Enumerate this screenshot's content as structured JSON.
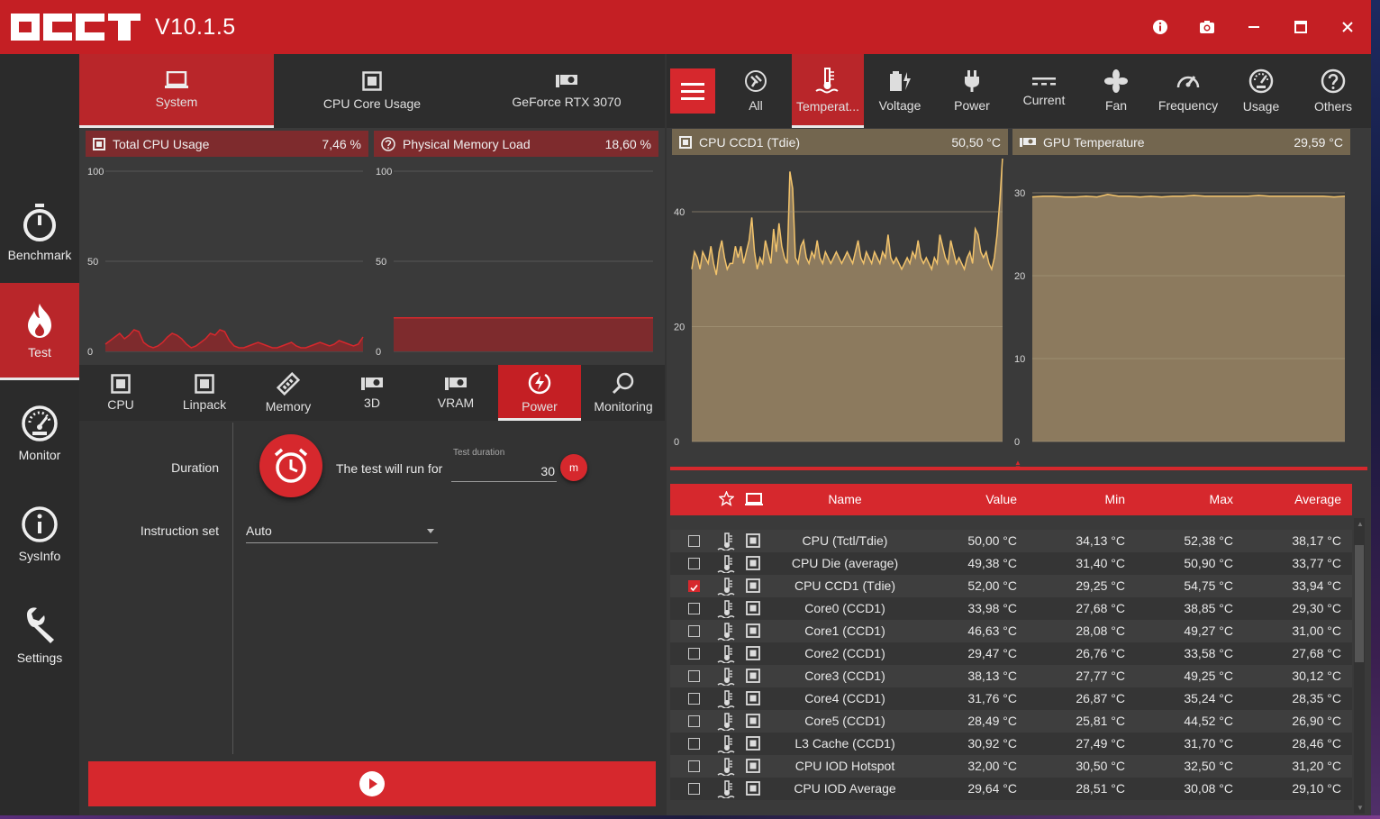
{
  "app": {
    "version": "V10.1.5"
  },
  "titlebar_buttons": [
    "info-icon",
    "camera-icon",
    "minimize-icon",
    "maximize-icon",
    "close-icon"
  ],
  "nav": [
    {
      "label": "Benchmark",
      "icon": "stopwatch-icon"
    },
    {
      "label": "Test",
      "icon": "flame-icon",
      "active": true
    },
    {
      "label": "Monitor",
      "icon": "gauge-icon"
    },
    {
      "label": "SysInfo",
      "icon": "info-icon"
    },
    {
      "label": "Settings",
      "icon": "wrench-icon"
    }
  ],
  "top_tabs": [
    {
      "label": "System",
      "icon": "laptop-icon",
      "active": true
    },
    {
      "label": "CPU Core Usage",
      "icon": "chip-icon"
    },
    {
      "label": "GeForce RTX 3070",
      "icon": "gpu-icon"
    }
  ],
  "system_charts": {
    "cpu": {
      "title": "Total CPU Usage",
      "value": "7,46 %"
    },
    "memory": {
      "title": "Physical Memory Load",
      "value": "18,60 %"
    }
  },
  "test_tabs": [
    {
      "label": "CPU",
      "icon": "chip-icon"
    },
    {
      "label": "Linpack",
      "icon": "chip-icon"
    },
    {
      "label": "Memory",
      "icon": "memory-icon"
    },
    {
      "label": "3D",
      "icon": "gpu-icon"
    },
    {
      "label": "VRAM",
      "icon": "gpu-icon"
    },
    {
      "label": "Power",
      "icon": "power-icon",
      "active": true
    },
    {
      "label": "Monitoring",
      "icon": "magnifier-icon"
    }
  ],
  "settings": {
    "duration_label": "Duration",
    "run_text": "The test will run for",
    "duration_caption": "Test duration",
    "duration_value": "30",
    "duration_unit": "m",
    "instruction_label": "Instruction set",
    "instruction_value": "Auto"
  },
  "monitor_tabs": [
    {
      "label": "All",
      "icon": "wrench-icon"
    },
    {
      "label": "Temperat...",
      "icon": "thermometer-icon",
      "active": true
    },
    {
      "label": "Voltage",
      "icon": "battery-icon"
    },
    {
      "label": "Power",
      "icon": "plug-icon"
    },
    {
      "label": "Current",
      "icon": "dc-current-icon"
    },
    {
      "label": "Fan",
      "icon": "fan-icon"
    },
    {
      "label": "Frequency",
      "icon": "speedometer-icon"
    },
    {
      "label": "Usage",
      "icon": "gauge-icon"
    },
    {
      "label": "Others",
      "icon": "question-icon"
    }
  ],
  "monitor_charts": {
    "cpu_ccd1": {
      "title": "CPU CCD1 (Tdie)",
      "value": "50,50 °C"
    },
    "gpu_temp": {
      "title": "GPU Temperature",
      "value": "29,59 °C"
    }
  },
  "chart_data": [
    {
      "type": "area",
      "title": "Total CPU Usage",
      "ylim": [
        0,
        100
      ],
      "yticks": [
        "100",
        "50",
        "0"
      ],
      "values": [
        4,
        6,
        8,
        10,
        7,
        9,
        12,
        11,
        5,
        3,
        2,
        3,
        5,
        8,
        10,
        9,
        7,
        4,
        2,
        3,
        5,
        7,
        10,
        9,
        12,
        11,
        6,
        3,
        2,
        2,
        3,
        4,
        5,
        4,
        3,
        2,
        2,
        3,
        4,
        5,
        3,
        2,
        2,
        3,
        4,
        5,
        4,
        3,
        4,
        6,
        5,
        4,
        3,
        4,
        8
      ]
    },
    {
      "type": "area",
      "title": "Physical Memory Load",
      "ylim": [
        0,
        100
      ],
      "yticks": [
        "100",
        "50",
        "0"
      ],
      "values": [
        18.6,
        18.6
      ]
    },
    {
      "type": "area",
      "title": "CPU CCD1 (Tdie)",
      "ylim": [
        0,
        48
      ],
      "yticks": [
        "40",
        "20",
        "0"
      ],
      "values": [
        30,
        33,
        32,
        30,
        33,
        32,
        31,
        34,
        31,
        29,
        33,
        35,
        32,
        30,
        31,
        31,
        34,
        32,
        34,
        31,
        33,
        35,
        39,
        33,
        30,
        32,
        31,
        35,
        33,
        31,
        37,
        33,
        38,
        34,
        32,
        31,
        47,
        44,
        32,
        31,
        34,
        35,
        32,
        31,
        33,
        32,
        35,
        32,
        31,
        33,
        32,
        31,
        32,
        33,
        32,
        31,
        32,
        33,
        32,
        31,
        33,
        35,
        32,
        31,
        33,
        32,
        31,
        33,
        32,
        31,
        33,
        32,
        36,
        32,
        31,
        32,
        31,
        30,
        31,
        32,
        31,
        33,
        32,
        35,
        32,
        31,
        32,
        31,
        30,
        32,
        31,
        36,
        34,
        32,
        31,
        35,
        33,
        31,
        32,
        31,
        30,
        32,
        33,
        31,
        37,
        36,
        33,
        32,
        33,
        31,
        30,
        32,
        36,
        42,
        49.5
      ]
    },
    {
      "type": "area",
      "title": "GPU Temperature",
      "ylim": [
        0,
        30
      ],
      "yticks": [
        "30",
        "20",
        "10",
        "0"
      ],
      "values": [
        29.5,
        29.6,
        29.6,
        29.5,
        29.5,
        29.6,
        29.5,
        29.8,
        29.6,
        29.6,
        29.5,
        29.6,
        29.5,
        29.6,
        29.6,
        29.7,
        29.6,
        29.6,
        29.6,
        29.6,
        29.6,
        29.7,
        29.6,
        29.6,
        29.6,
        29.6,
        29.6,
        29.6,
        29.5,
        29.6
      ]
    }
  ],
  "table": {
    "headers": {
      "name": "Name",
      "value": "Value",
      "min": "Min",
      "max": "Max",
      "average": "Average"
    },
    "rows": [
      {
        "checked": false,
        "name": "CPU (Tctl/Tdie)",
        "value": "50,00 °C",
        "min": "34,13 °C",
        "max": "52,38 °C",
        "avg": "38,17 °C"
      },
      {
        "checked": false,
        "name": "CPU Die (average)",
        "value": "49,38 °C",
        "min": "31,40 °C",
        "max": "50,90 °C",
        "avg": "33,77 °C"
      },
      {
        "checked": true,
        "name": "CPU CCD1 (Tdie)",
        "value": "52,00 °C",
        "min": "29,25 °C",
        "max": "54,75 °C",
        "avg": "33,94 °C"
      },
      {
        "checked": false,
        "name": "Core0 (CCD1)",
        "value": "33,98 °C",
        "min": "27,68 °C",
        "max": "38,85 °C",
        "avg": "29,30 °C"
      },
      {
        "checked": false,
        "name": "Core1 (CCD1)",
        "value": "46,63 °C",
        "min": "28,08 °C",
        "max": "49,27 °C",
        "avg": "31,00 °C"
      },
      {
        "checked": false,
        "name": "Core2 (CCD1)",
        "value": "29,47 °C",
        "min": "26,76 °C",
        "max": "33,58 °C",
        "avg": "27,68 °C"
      },
      {
        "checked": false,
        "name": "Core3 (CCD1)",
        "value": "38,13 °C",
        "min": "27,77 °C",
        "max": "49,25 °C",
        "avg": "30,12 °C"
      },
      {
        "checked": false,
        "name": "Core4 (CCD1)",
        "value": "31,76 °C",
        "min": "26,87 °C",
        "max": "35,24 °C",
        "avg": "28,35 °C"
      },
      {
        "checked": false,
        "name": "Core5 (CCD1)",
        "value": "28,49 °C",
        "min": "25,81 °C",
        "max": "44,52 °C",
        "avg": "26,90 °C"
      },
      {
        "checked": false,
        "name": "L3 Cache (CCD1)",
        "value": "30,92 °C",
        "min": "27,49 °C",
        "max": "31,70 °C",
        "avg": "28,46 °C"
      },
      {
        "checked": false,
        "name": "CPU IOD Hotspot",
        "value": "32,00 °C",
        "min": "30,50 °C",
        "max": "32,50 °C",
        "avg": "31,20 °C"
      },
      {
        "checked": false,
        "name": "CPU IOD Average",
        "value": "29,64 °C",
        "min": "28,51 °C",
        "max": "30,08 °C",
        "avg": "29,10 °C"
      }
    ]
  },
  "colors": {
    "accent": "#d6282d",
    "titlebar": "#c41f24",
    "cpu_chart_fill": "#7e2b2d",
    "temp_chart_fill": "#8c7a5e",
    "temp_line": "#f2c36b"
  }
}
